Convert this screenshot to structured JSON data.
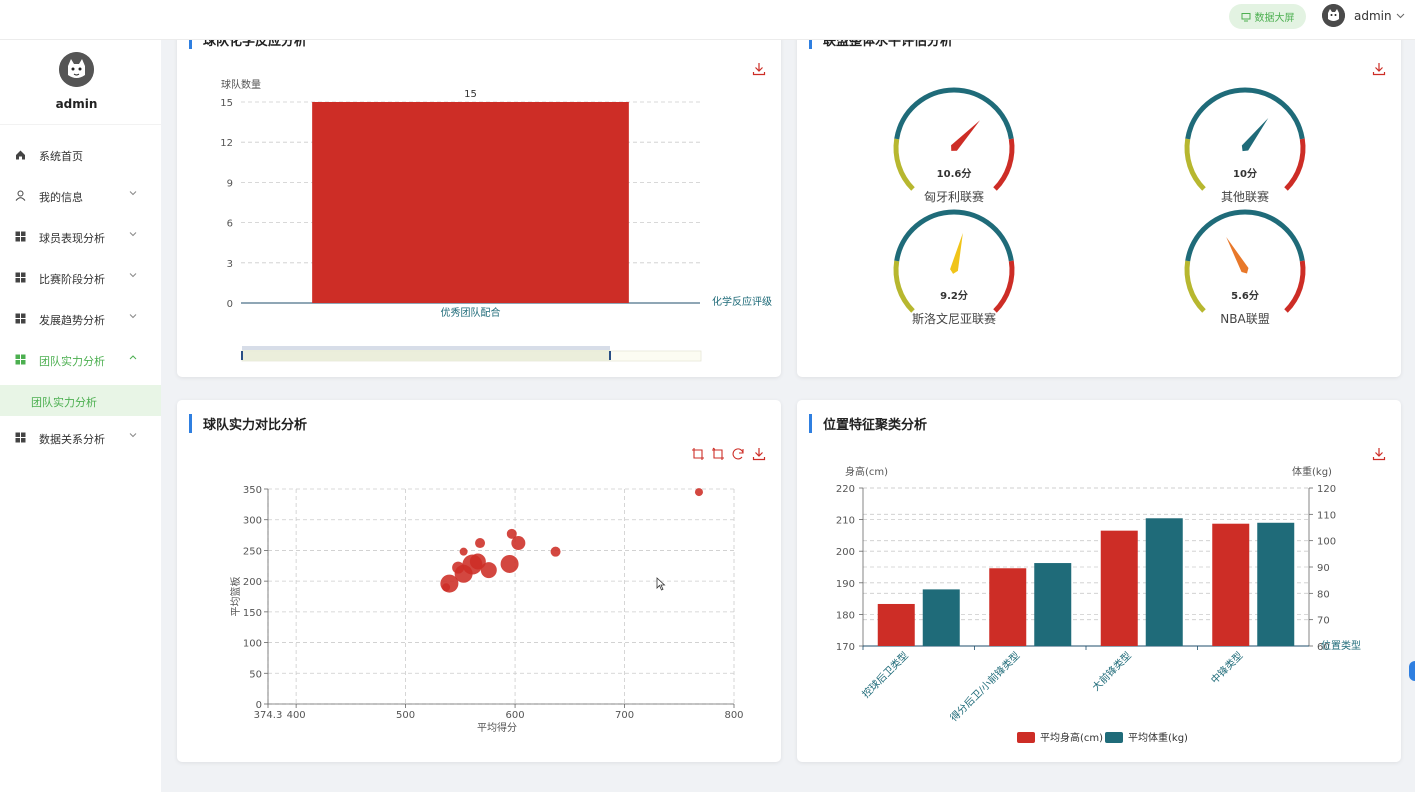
{
  "topbar": {
    "bigscreen_label": "数据大屏",
    "username": "admin"
  },
  "sidebar": {
    "username": "admin",
    "items": [
      {
        "label": "系统首页",
        "icon": "home-icon",
        "has_arrow": false,
        "active": false
      },
      {
        "label": "我的信息",
        "icon": "user-icon",
        "has_arrow": true,
        "active": false
      },
      {
        "label": "球员表现分析",
        "icon": "grid-icon",
        "has_arrow": true,
        "active": false
      },
      {
        "label": "比赛阶段分析",
        "icon": "grid-icon",
        "has_arrow": true,
        "active": false
      },
      {
        "label": "发展趋势分析",
        "icon": "grid-icon",
        "has_arrow": true,
        "active": false
      },
      {
        "label": "团队实力分析",
        "icon": "grid-icon",
        "has_arrow": true,
        "active": true,
        "expanded": true
      },
      {
        "label": "数据关系分析",
        "icon": "grid-icon",
        "has_arrow": true,
        "active": false
      }
    ],
    "submenu_label": "团队实力分析"
  },
  "colors": {
    "accent": "#4caf50",
    "red": "#cd2d26",
    "teal": "#1f6b79",
    "olive": "#b7b72f",
    "title_bar": "#2f7fe0"
  },
  "cards": {
    "top_left": {
      "title": "球队化学反应分析"
    },
    "top_right": {
      "title": "联盟整体水平评估分析"
    },
    "bottom_left": {
      "title": "球队实力对比分析"
    },
    "bottom_right": {
      "title": "位置特征聚类分析"
    }
  },
  "chart_data": [
    {
      "type": "bar",
      "categories": [
        "优秀团队配合"
      ],
      "values": [
        15
      ],
      "ylabel": "球队数量",
      "xlabel": "化学反应评级",
      "ylim": [
        0,
        15
      ],
      "yticks": [
        0,
        3,
        6,
        9,
        12,
        15
      ],
      "data_labels": [
        "15"
      ],
      "color": "#cd2d26",
      "grid": true,
      "datazoom": true
    },
    {
      "type": "gauge",
      "gauges": [
        {
          "name": "匈牙利联赛",
          "value_label": "10.6分",
          "needle_color": "#cd2d26",
          "level": 0.66
        },
        {
          "name": "其他联赛",
          "value_label": "10分",
          "needle_color": "#1f6b79",
          "level": 0.64
        },
        {
          "name": "斯洛文尼亚联赛",
          "value_label": "9.2分",
          "needle_color": "#f0c419",
          "level": 0.55
        },
        {
          "name": "NBA联盟",
          "value_label": "5.6分",
          "needle_color": "#e8782a",
          "level": 0.39
        }
      ]
    },
    {
      "type": "scatter",
      "xlabel": "平均得分",
      "ylabel": "平均篮板",
      "xlim": [
        374.3,
        800
      ],
      "ylim": [
        0,
        350
      ],
      "xticks": [
        "374.3",
        "400",
        "500",
        "600",
        "700",
        "800"
      ],
      "yticks": [
        0,
        50,
        100,
        150,
        200,
        250,
        300,
        350
      ],
      "color": "#cd2d26",
      "grid": true,
      "points": [
        {
          "x": 768,
          "y": 345,
          "r": 4
        },
        {
          "x": 637,
          "y": 248,
          "r": 5
        },
        {
          "x": 603,
          "y": 262,
          "r": 7
        },
        {
          "x": 597,
          "y": 277,
          "r": 5
        },
        {
          "x": 595,
          "y": 228,
          "r": 9
        },
        {
          "x": 568,
          "y": 262,
          "r": 5
        },
        {
          "x": 576,
          "y": 218,
          "r": 8
        },
        {
          "x": 566,
          "y": 232,
          "r": 8
        },
        {
          "x": 561,
          "y": 227,
          "r": 10
        },
        {
          "x": 553,
          "y": 248,
          "r": 4
        },
        {
          "x": 553,
          "y": 212,
          "r": 9
        },
        {
          "x": 548,
          "y": 222,
          "r": 6
        },
        {
          "x": 540,
          "y": 196,
          "r": 9
        },
        {
          "x": 537,
          "y": 190,
          "r": 4
        }
      ]
    },
    {
      "type": "bar",
      "categories": [
        "控球后卫类型",
        "得分后卫/小前锋类型",
        "大前锋类型",
        "中锋类型"
      ],
      "xlabel": "位置类型",
      "y_left_label": "身高(cm)",
      "y_right_label": "体重(kg)",
      "ylim_left": [
        170,
        220
      ],
      "ylim_right": [
        60,
        120
      ],
      "yticks_left": [
        170,
        180,
        190,
        200,
        210,
        220
      ],
      "yticks_right": [
        60,
        70,
        80,
        90,
        100,
        110,
        120
      ],
      "series": [
        {
          "name": "平均身高(cm)",
          "axis": "left",
          "color": "#cd2d26",
          "values": [
            183.3,
            194.6,
            206.5,
            208.7
          ]
        },
        {
          "name": "平均体重(kg)",
          "axis": "right",
          "color": "#1f6b79",
          "values": [
            81.5,
            91.5,
            108.5,
            106.8
          ]
        }
      ],
      "legend_position": "bottom-center",
      "grid": true
    }
  ]
}
